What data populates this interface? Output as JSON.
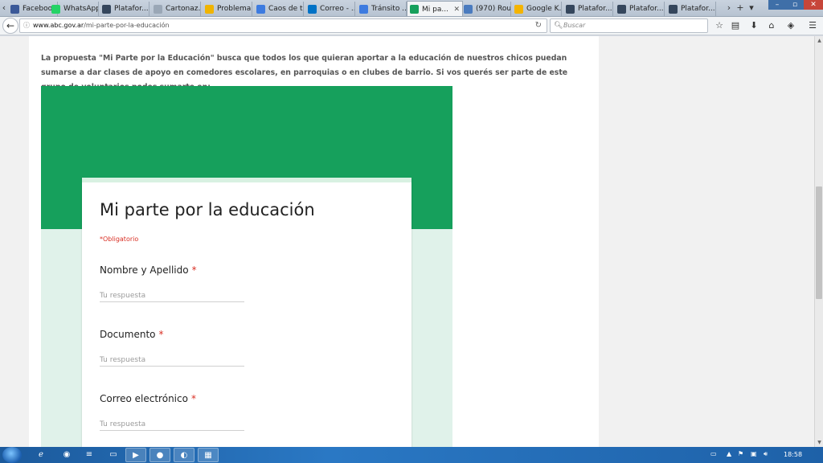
{
  "tabs": [
    {
      "label": "Facebook",
      "icon": "facebook-icon",
      "color": "#3b5998"
    },
    {
      "label": "WhatsApp",
      "icon": "whatsapp-icon",
      "color": "#25d366"
    },
    {
      "label": "Platafor...",
      "icon": "tumblr-icon",
      "color": "#35465c"
    },
    {
      "label": "Cartonaz...",
      "icon": "page-icon",
      "color": "#9aa7b6"
    },
    {
      "label": "Problema...",
      "icon": "warning-icon",
      "color": "#f0b400"
    },
    {
      "label": "Caos de t...",
      "icon": "loading-icon",
      "color": "#3d7be0"
    },
    {
      "label": "Correo - ...",
      "icon": "outlook-icon",
      "color": "#0072c6"
    },
    {
      "label": "Tránsito ...",
      "icon": "loading-icon",
      "color": "#3d7be0"
    },
    {
      "label": "Mi pa...",
      "icon": "forms-icon",
      "color": "#16a05c",
      "active": true
    },
    {
      "label": "(970) Rou...",
      "icon": "globe-icon",
      "color": "#4a7bbf"
    },
    {
      "label": "Google K...",
      "icon": "keep-icon",
      "color": "#f4b400"
    },
    {
      "label": "Platafor...",
      "icon": "tumblr-icon",
      "color": "#35465c"
    },
    {
      "label": "Platafor...",
      "icon": "tumblr-icon",
      "color": "#35465c"
    },
    {
      "label": "Platafor...",
      "icon": "tumblr-icon",
      "color": "#35465c"
    }
  ],
  "navbar": {
    "url_host": "www.abc.gov.ar",
    "url_path": "/mi-parte-por-la-educación",
    "search_placeholder": "Buscar"
  },
  "page": {
    "intro": "La propuesta \"Mi Parte por la Educación\" busca que todos los que quieran aportar a la educación de nuestros chicos puedan sumarse a dar clases de apoyo en comedores escolares, en parroquias o en clubes de barrio. Si vos querés ser parte de este grupo de voluntarios podes sumarte en:"
  },
  "form": {
    "title": "Mi parte por la educación",
    "required_note": "*Obligatorio",
    "banner_color": "#16a05c",
    "questions": [
      {
        "label": "Nombre y Apellido",
        "required": "*",
        "placeholder": "Tu respuesta"
      },
      {
        "label": "Documento",
        "required": "*",
        "placeholder": "Tu respuesta"
      },
      {
        "label": "Correo electrónico",
        "required": "*",
        "placeholder": "Tu respuesta"
      }
    ]
  },
  "taskbar": {
    "clock": "18:58"
  }
}
